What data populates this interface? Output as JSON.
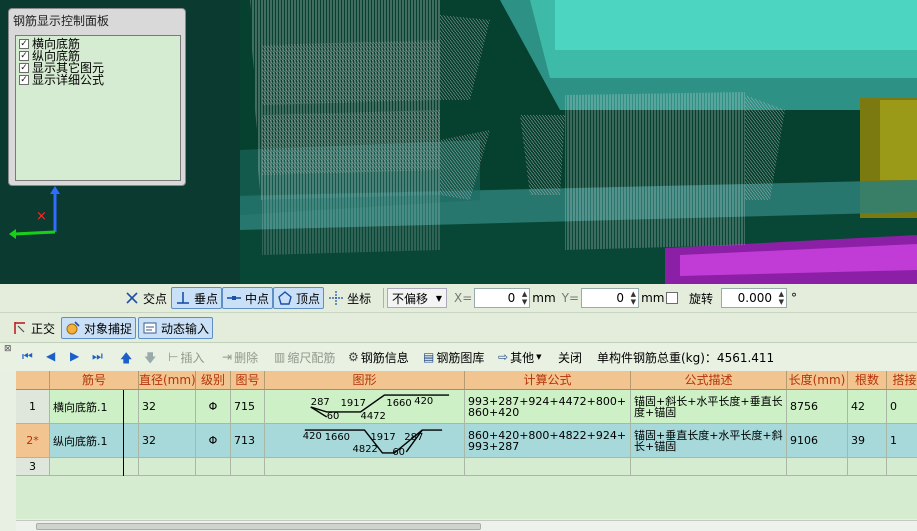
{
  "panel": {
    "title": "钢筋显示控制面板",
    "items": [
      {
        "label": "横向底筋",
        "checked": true
      },
      {
        "label": "纵向底筋",
        "checked": true
      },
      {
        "label": "显示其它图元",
        "checked": true
      },
      {
        "label": "显示详细公式",
        "checked": true
      }
    ]
  },
  "snap": {
    "intersection": "交点",
    "perpendicular": "垂点",
    "midpoint": "中点",
    "vertex": "顶点",
    "coordinate": "坐标",
    "offset_value": "不偏移",
    "x_label": "X=",
    "x_value": "0",
    "x_unit": "mm",
    "y_label": "Y=",
    "y_value": "0",
    "y_unit": "mm",
    "rotate_label": "旋转",
    "rotate_value": "0.000",
    "rotate_unit": "°"
  },
  "modes": {
    "ortho": "正交",
    "object_snap": "对象捕捉",
    "dynamic_input": "动态输入"
  },
  "rebar_toolbar": {
    "insert": "插入",
    "delete": "删除",
    "scale": "缩尺配筋",
    "info": "钢筋信息",
    "library": "钢筋图库",
    "other": "其他",
    "close": "关闭",
    "total_label": "单构件钢筋总重(kg)：4561.411"
  },
  "table": {
    "headers": [
      "筋号",
      "直径(mm)",
      "级别",
      "图号",
      "图形",
      "计算公式",
      "公式描述",
      "长度(mm)",
      "根数",
      "搭接"
    ],
    "rows": [
      {
        "num": "1",
        "name": "横向底筋.1",
        "diameter": "32",
        "grade": "Φ",
        "figure": "715",
        "shape": {
          "a": "287",
          "b": "1917",
          "c": "1660",
          "d": "420",
          "e": "60",
          "f": "4472"
        },
        "formula": "993+287+924+4472+800+860+420",
        "desc": "锚固+斜长+水平长度+垂直长度+锚固",
        "length": "8756",
        "count": "42",
        "lap": "0"
      },
      {
        "num": "2*",
        "name": "纵向底筋.1",
        "diameter": "32",
        "grade": "Φ",
        "figure": "713",
        "shape": {
          "a": "420",
          "b": "1660",
          "c": "1917",
          "d": "287",
          "e": "4822",
          "f": "60"
        },
        "formula": "860+420+800+4822+924+993+287",
        "desc": "锚固+垂直长度+水平长度+斜长+锚固",
        "length": "9106",
        "count": "39",
        "lap": "1"
      },
      {
        "num": "3"
      }
    ]
  },
  "colors": {
    "viewport_bg": "#05402f",
    "header_bg": "#f2c590",
    "header_text": "#b43309",
    "row_selected": "#a7d9db",
    "row_normal": "#cdf0c6"
  }
}
